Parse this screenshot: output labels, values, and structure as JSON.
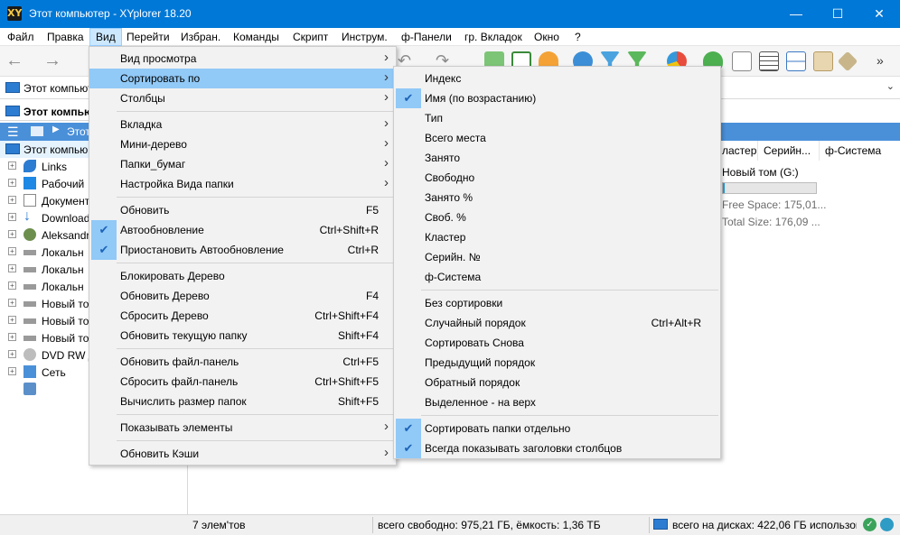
{
  "window": {
    "title": "Этот компьютер - XYplorer 18.20",
    "app_icon": "XY"
  },
  "menubar": [
    "Файл",
    "Правка",
    "Вид",
    "Перейти",
    "Избран.",
    "Команды",
    "Скрипт",
    "Инструм.",
    "ф-Панели",
    "гр. Вкладок",
    "Окно",
    "?"
  ],
  "address": {
    "value": "Этот компьют"
  },
  "tree_header": {
    "title": "Этот компьют"
  },
  "tabbar": {
    "tab_label": "Этот"
  },
  "tree": {
    "root": "Этот компью",
    "items": [
      "Links",
      "Рабочий",
      "Документ",
      "Download",
      "Aleksandr",
      "Локальн",
      "Локальн",
      "Локальн",
      "Новый то",
      "Новый то",
      "Новый то",
      "DVD RW д",
      "Сеть"
    ]
  },
  "columns": [
    "ластер",
    "Серийн...",
    "ф-Система"
  ],
  "drive_tile": {
    "name": "Новый том (G:)",
    "used_fraction": 0.005,
    "free": "Free Space: 175,01...",
    "total": "Total Size: 176,09 ..."
  },
  "status": {
    "items": "7 элем'тов",
    "free": "всего свободно: 975,21 ГБ, ёмкость: 1,36 ТБ",
    "disks": "всего на дисках: 422,06 ГБ использова"
  },
  "view_menu": [
    {
      "label": "Вид просмотра",
      "submenu": true
    },
    {
      "label": "Сортировать по",
      "submenu": true,
      "highlighted": true
    },
    {
      "label": "Столбцы",
      "submenu": true
    },
    {
      "separator": true
    },
    {
      "label": "Вкладка",
      "submenu": true
    },
    {
      "label": "Мини-дерево",
      "submenu": true
    },
    {
      "label": "Папки_бумаг",
      "submenu": true
    },
    {
      "label": "Настройка Вида папки",
      "submenu": true
    },
    {
      "separator": true
    },
    {
      "label": "Обновить",
      "shortcut": "F5"
    },
    {
      "label": "Автообновление",
      "shortcut": "Ctrl+Shift+R",
      "checked": true
    },
    {
      "label": "Приостановить Автообновление",
      "shortcut": "Ctrl+R",
      "checked": true
    },
    {
      "separator": true
    },
    {
      "label": "Блокировать Дерево"
    },
    {
      "label": "Обновить Дерево",
      "shortcut": "F4"
    },
    {
      "label": "Сбросить Дерево",
      "shortcut": "Ctrl+Shift+F4"
    },
    {
      "label": "Обновить текущую папку",
      "shortcut": "Shift+F4"
    },
    {
      "separator": true
    },
    {
      "label": "Обновить файл-панель",
      "shortcut": "Ctrl+F5"
    },
    {
      "label": "Сбросить файл-панель",
      "shortcut": "Ctrl+Shift+F5"
    },
    {
      "label": "Вычислить размер папок",
      "shortcut": "Shift+F5"
    },
    {
      "separator": true
    },
    {
      "label": "Показывать элементы",
      "submenu": true
    },
    {
      "separator": true
    },
    {
      "label": "Обновить Кэши",
      "submenu": true
    }
  ],
  "sort_menu": [
    {
      "label": "Индекс"
    },
    {
      "label": "Имя (по возрастанию)",
      "checked": true
    },
    {
      "label": "Тип"
    },
    {
      "label": "Всего места"
    },
    {
      "label": "Занято"
    },
    {
      "label": "Свободно"
    },
    {
      "label": "Занято %"
    },
    {
      "label": "Своб. %"
    },
    {
      "label": "Кластер"
    },
    {
      "label": "Серийн. №"
    },
    {
      "label": "ф-Система"
    },
    {
      "separator": true
    },
    {
      "label": "Без сортировки"
    },
    {
      "label": "Случайный порядок",
      "shortcut": "Ctrl+Alt+R"
    },
    {
      "label": "Сортировать Снова"
    },
    {
      "label": "Предыдущий порядок"
    },
    {
      "label": "Обратный порядок"
    },
    {
      "label": "Выделенное - на верх"
    },
    {
      "separator": true
    },
    {
      "label": "Сортировать папки отдельно",
      "checked": true
    },
    {
      "label": "Всегда показывать заголовки столбцов",
      "checked": true
    }
  ],
  "colors": {
    "accent": "#0078d7",
    "menu_highlight": "#91c9f7",
    "tab_bar": "#4a90d9"
  }
}
